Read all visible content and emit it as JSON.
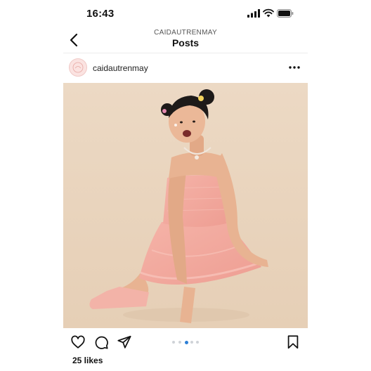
{
  "status_bar": {
    "time": "16:43",
    "icons": [
      "cellular-signal-icon",
      "wifi-icon",
      "battery-icon"
    ]
  },
  "nav": {
    "account": "CAIDAUTRENMAY",
    "title": "Posts",
    "back_icon": "chevron-left-icon"
  },
  "post": {
    "username": "caidautrenmay",
    "more_icon": "more-horizontal-icon",
    "image_description": "photo",
    "carousel": {
      "count": 5,
      "active_index": 2
    },
    "likes": "25 likes"
  },
  "actions": {
    "icons": [
      "heart-icon",
      "comment-icon",
      "send-icon",
      "bookmark-icon"
    ]
  },
  "colors": {
    "photo_background": "#ead6c0",
    "dress": "#f3a89d",
    "active_dot": "#2d7fd6",
    "inactive_dot": "#cfd3d8"
  }
}
